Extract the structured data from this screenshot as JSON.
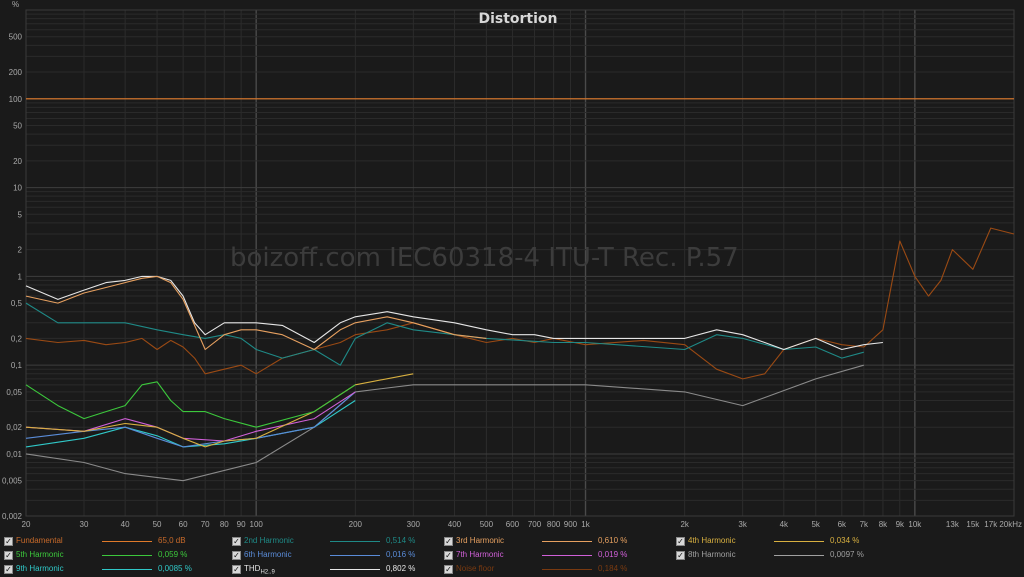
{
  "chart_data": {
    "type": "line",
    "title": "Distortion",
    "watermark": "boizoff.com IEC60318-4 ITU-T Rec. P.57",
    "y_unit": "%",
    "x_scale": "log",
    "y_scale": "log",
    "xlim": [
      20,
      20000
    ],
    "ylim": [
      0.002,
      1000
    ],
    "grid": true,
    "legend_position": "bottom",
    "y_ticks": [
      {
        "value": 500,
        "label": "500"
      },
      {
        "value": 200,
        "label": "200"
      },
      {
        "value": 100,
        "label": "100"
      },
      {
        "value": 50,
        "label": "50"
      },
      {
        "value": 20,
        "label": "20"
      },
      {
        "value": 10,
        "label": "10"
      },
      {
        "value": 5,
        "label": "5"
      },
      {
        "value": 2,
        "label": "2"
      },
      {
        "value": 1,
        "label": "1"
      },
      {
        "value": 0.5,
        "label": "0,5"
      },
      {
        "value": 0.2,
        "label": "0,2"
      },
      {
        "value": 0.1,
        "label": "0,1"
      },
      {
        "value": 0.05,
        "label": "0,05"
      },
      {
        "value": 0.02,
        "label": "0,02"
      },
      {
        "value": 0.01,
        "label": "0,01"
      },
      {
        "value": 0.005,
        "label": "0,005"
      },
      {
        "value": 0.002,
        "label": "0,002"
      }
    ],
    "x_ticks": [
      {
        "value": 20,
        "label": "20"
      },
      {
        "value": 30,
        "label": "30"
      },
      {
        "value": 40,
        "label": "40"
      },
      {
        "value": 50,
        "label": "50"
      },
      {
        "value": 60,
        "label": "60"
      },
      {
        "value": 70,
        "label": "70"
      },
      {
        "value": 80,
        "label": "80"
      },
      {
        "value": 90,
        "label": "90"
      },
      {
        "value": 100,
        "label": "100"
      },
      {
        "value": 200,
        "label": "200"
      },
      {
        "value": 300,
        "label": "300"
      },
      {
        "value": 400,
        "label": "400"
      },
      {
        "value": 500,
        "label": "500"
      },
      {
        "value": 600,
        "label": "600"
      },
      {
        "value": 700,
        "label": "700"
      },
      {
        "value": 800,
        "label": "800"
      },
      {
        "value": 900,
        "label": "900"
      },
      {
        "value": 1000,
        "label": "1k"
      },
      {
        "value": 2000,
        "label": "2k"
      },
      {
        "value": 3000,
        "label": "3k"
      },
      {
        "value": 4000,
        "label": "4k"
      },
      {
        "value": 5000,
        "label": "5k"
      },
      {
        "value": 6000,
        "label": "6k"
      },
      {
        "value": 7000,
        "label": "7k"
      },
      {
        "value": 8000,
        "label": "8k"
      },
      {
        "value": 9000,
        "label": "9k"
      },
      {
        "value": 10000,
        "label": "10k"
      },
      {
        "value": 13000,
        "label": "13k"
      },
      {
        "value": 15000,
        "label": "15k"
      },
      {
        "value": 17000,
        "label": "17k"
      },
      {
        "value": 20000,
        "label": "20kHz"
      }
    ],
    "series": [
      {
        "name": "Fundamental",
        "color": "#e07a2a",
        "style": "flat",
        "x": [
          20,
          20000
        ],
        "y": [
          100,
          100
        ]
      },
      {
        "name": "Noise floor",
        "color": "#9a4a14",
        "x": [
          20,
          25,
          30,
          35,
          40,
          45,
          50,
          55,
          60,
          65,
          70,
          80,
          90,
          100,
          120,
          150,
          180,
          200,
          250,
          300,
          400,
          500,
          600,
          700,
          800,
          1000,
          1500,
          2000,
          2500,
          3000,
          3500,
          4000,
          5000,
          6000,
          7000,
          8000,
          9000,
          10000,
          11000,
          12000,
          13000,
          15000,
          17000,
          20000
        ],
        "y": [
          0.2,
          0.18,
          0.19,
          0.17,
          0.18,
          0.2,
          0.15,
          0.19,
          0.16,
          0.12,
          0.08,
          0.09,
          0.1,
          0.08,
          0.12,
          0.15,
          0.18,
          0.22,
          0.25,
          0.3,
          0.22,
          0.18,
          0.2,
          0.18,
          0.2,
          0.17,
          0.19,
          0.17,
          0.09,
          0.07,
          0.08,
          0.15,
          0.2,
          0.17,
          0.16,
          0.25,
          2.5,
          1.0,
          0.6,
          0.9,
          2.0,
          1.2,
          3.5,
          3.0
        ]
      },
      {
        "name": "THD H2..9",
        "color": "#e6e6e6",
        "x": [
          20,
          25,
          30,
          35,
          40,
          45,
          50,
          55,
          60,
          65,
          70,
          80,
          90,
          100,
          120,
          150,
          180,
          200,
          250,
          300,
          400,
          500,
          600,
          700,
          800,
          1000,
          1500,
          2000,
          2500,
          3000,
          3500,
          4000,
          5000,
          6000,
          7000,
          8000
        ],
        "y": [
          0.78,
          0.55,
          0.7,
          0.85,
          0.9,
          1.0,
          1.0,
          0.9,
          0.6,
          0.3,
          0.22,
          0.3,
          0.3,
          0.3,
          0.28,
          0.18,
          0.3,
          0.35,
          0.4,
          0.35,
          0.3,
          0.25,
          0.22,
          0.22,
          0.2,
          0.2,
          0.2,
          0.2,
          0.25,
          0.22,
          0.18,
          0.15,
          0.2,
          0.15,
          0.17,
          0.18
        ]
      },
      {
        "name": "2nd Harmonic",
        "color": "#1f8a87",
        "x": [
          20,
          25,
          30,
          40,
          50,
          60,
          70,
          80,
          90,
          100,
          120,
          150,
          180,
          200,
          250,
          300,
          500,
          800,
          1000,
          2000,
          2500,
          3000,
          4000,
          5000,
          6000,
          7000
        ],
        "y": [
          0.5,
          0.3,
          0.3,
          0.3,
          0.25,
          0.22,
          0.2,
          0.22,
          0.2,
          0.15,
          0.12,
          0.15,
          0.1,
          0.2,
          0.3,
          0.25,
          0.2,
          0.18,
          0.18,
          0.15,
          0.22,
          0.2,
          0.15,
          0.16,
          0.12,
          0.14
        ]
      },
      {
        "name": "3rd Harmonic",
        "color": "#e6a060",
        "x": [
          20,
          25,
          30,
          35,
          40,
          45,
          50,
          55,
          60,
          65,
          70,
          80,
          90,
          100,
          120,
          150,
          180,
          200,
          250,
          300,
          400,
          500
        ],
        "y": [
          0.6,
          0.5,
          0.65,
          0.75,
          0.85,
          0.95,
          1.0,
          0.85,
          0.55,
          0.28,
          0.15,
          0.22,
          0.25,
          0.25,
          0.22,
          0.15,
          0.25,
          0.3,
          0.35,
          0.3,
          0.22,
          0.2
        ]
      },
      {
        "name": "4th Harmonic",
        "color": "#d8b040",
        "x": [
          20,
          30,
          40,
          50,
          60,
          70,
          80,
          100,
          150,
          200,
          300
        ],
        "y": [
          0.02,
          0.018,
          0.022,
          0.02,
          0.015,
          0.012,
          0.014,
          0.015,
          0.03,
          0.06,
          0.08
        ]
      },
      {
        "name": "5th Harmonic",
        "color": "#3cc83c",
        "x": [
          20,
          25,
          30,
          35,
          40,
          45,
          50,
          55,
          60,
          70,
          80,
          100,
          150,
          200
        ],
        "y": [
          0.06,
          0.035,
          0.025,
          0.03,
          0.035,
          0.06,
          0.065,
          0.04,
          0.03,
          0.03,
          0.025,
          0.02,
          0.03,
          0.06
        ]
      },
      {
        "name": "6th Harmonic",
        "color": "#5a8cd8",
        "x": [
          20,
          30,
          40,
          50,
          60,
          80,
          100,
          150,
          200
        ],
        "y": [
          0.015,
          0.018,
          0.02,
          0.015,
          0.012,
          0.014,
          0.015,
          0.02,
          0.05
        ]
      },
      {
        "name": "7th Harmonic",
        "color": "#d060d8",
        "x": [
          20,
          30,
          40,
          50,
          60,
          80,
          100,
          150,
          200
        ],
        "y": [
          0.02,
          0.018,
          0.025,
          0.02,
          0.015,
          0.014,
          0.018,
          0.025,
          0.05
        ]
      },
      {
        "name": "8th Harmonic",
        "color": "#8a8a8a",
        "x": [
          20,
          30,
          40,
          60,
          100,
          150,
          200,
          300,
          500,
          1000,
          2000,
          3000,
          5000,
          7000
        ],
        "y": [
          0.01,
          0.008,
          0.006,
          0.005,
          0.008,
          0.02,
          0.05,
          0.06,
          0.06,
          0.06,
          0.05,
          0.035,
          0.07,
          0.1
        ]
      },
      {
        "name": "9th Harmonic",
        "color": "#30c8c8",
        "x": [
          20,
          30,
          40,
          50,
          60,
          80,
          100,
          150,
          200
        ],
        "y": [
          0.012,
          0.015,
          0.02,
          0.016,
          0.012,
          0.013,
          0.015,
          0.02,
          0.04
        ]
      }
    ]
  },
  "legend": {
    "rows": [
      [
        {
          "name": "Fundamental",
          "value": "65,0 dB",
          "color": "#e07a2a",
          "text_color": "#c86a2a"
        },
        {
          "name": "2nd Harmonic",
          "value": "0,514 %",
          "color": "#1f8a87",
          "text_color": "#1f8a87"
        },
        {
          "name": "3rd Harmonic",
          "value": "0,610 %",
          "color": "#e6a060",
          "text_color": "#e6a060"
        },
        {
          "name": "4th Harmonic",
          "value": "0,034 %",
          "color": "#d8b040",
          "text_color": "#d8b040"
        }
      ],
      [
        {
          "name": "5th Harmonic",
          "value": "0,059 %",
          "color": "#3cc83c",
          "text_color": "#3cc83c"
        },
        {
          "name": "6th Harmonic",
          "value": "0,016 %",
          "color": "#5a8cd8",
          "text_color": "#5a8cd8"
        },
        {
          "name": "7th Harmonic",
          "value": "0,019 %",
          "color": "#d060d8",
          "text_color": "#d060d8"
        },
        {
          "name": "8th Harmonic",
          "value": "0,0097 %",
          "color": "#a0a0a0",
          "text_color": "#a0a0a0"
        }
      ],
      [
        {
          "name": "9th Harmonic",
          "value": "0,0085 %",
          "color": "#30c8c8",
          "text_color": "#30c8c8"
        },
        {
          "name": "THD",
          "name_sub": "H2..9",
          "value": "0,802 %",
          "color": "#e6e6e6",
          "text_color": "#e6e6e6"
        },
        {
          "name": "Noise floor",
          "value": "0,184 %",
          "color": "#7a3a10",
          "text_color": "#7a3a10"
        }
      ]
    ]
  }
}
